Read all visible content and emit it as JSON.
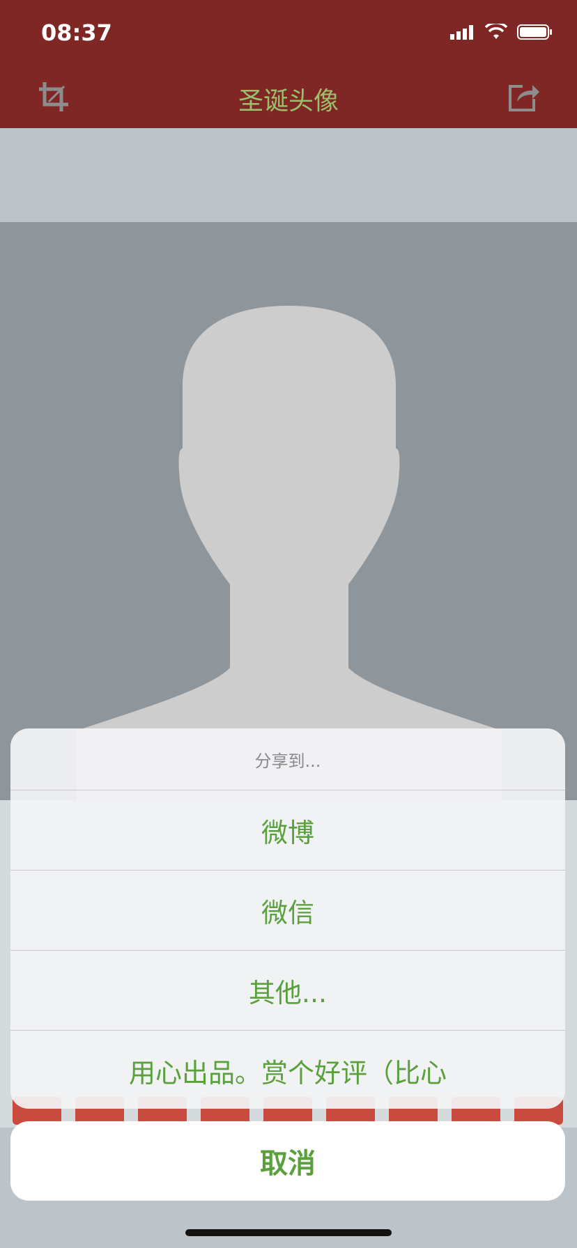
{
  "status_bar": {
    "time": "08:37"
  },
  "nav": {
    "title": "圣诞头像",
    "left_icon": "crop-icon",
    "right_icon": "share-icon"
  },
  "colors": {
    "accent": "#7f2724",
    "green": "#5aa03c",
    "title_green": "#9bbf6a"
  },
  "action_sheet": {
    "title": "分享到...",
    "items": [
      {
        "label": "微博"
      },
      {
        "label": "微信"
      },
      {
        "label": "其他..."
      },
      {
        "label": "用心出品。赏个好评（比心"
      }
    ],
    "cancel": "取消"
  }
}
